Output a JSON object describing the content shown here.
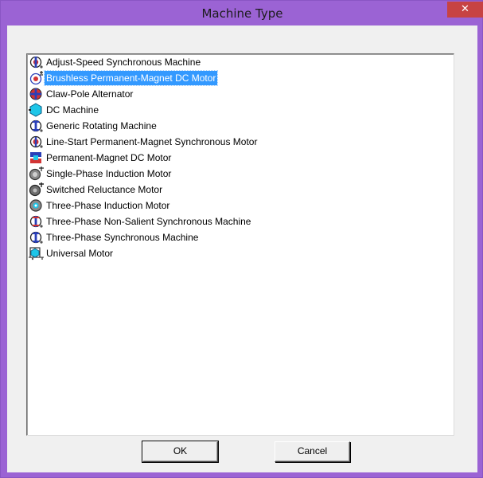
{
  "window": {
    "title": "Machine Type",
    "close_glyph": "✕"
  },
  "machine_list": {
    "selected_index": 1,
    "items": [
      {
        "label": "Adjust-Speed  Synchronous Machine",
        "icon": "synchronous-machine-icon"
      },
      {
        "label": "Brushless Permanent-Magnet DC Motor",
        "icon": "brushless-dc-motor-icon"
      },
      {
        "label": "Claw-Pole Alternator",
        "icon": "claw-pole-alternator-icon"
      },
      {
        "label": "DC Machine",
        "icon": "dc-machine-icon"
      },
      {
        "label": "Generic Rotating Machine",
        "icon": "generic-machine-icon"
      },
      {
        "label": "Line-Start Permanent-Magnet Synchronous Motor",
        "icon": "line-start-motor-icon"
      },
      {
        "label": "Permanent-Magnet DC Motor",
        "icon": "pm-dc-motor-icon"
      },
      {
        "label": "Single-Phase Induction Motor",
        "icon": "single-phase-motor-icon"
      },
      {
        "label": "Switched Reluctance Motor",
        "icon": "switched-reluctance-motor-icon"
      },
      {
        "label": "Three-Phase Induction Motor",
        "icon": "three-phase-induction-motor-icon"
      },
      {
        "label": "Three-Phase Non-Salient Synchronous Machine",
        "icon": "non-salient-synchronous-icon"
      },
      {
        "label": "Three-Phase Synchronous Machine",
        "icon": "three-phase-synchronous-icon"
      },
      {
        "label": "Universal Motor",
        "icon": "universal-motor-icon"
      }
    ]
  },
  "buttons": {
    "ok_label": "OK",
    "cancel_label": "Cancel"
  },
  "colors": {
    "title_bar": "#9b63d4",
    "close_button": "#c74343",
    "selection": "#3399ff",
    "dialog_face": "#f0f0f0"
  }
}
